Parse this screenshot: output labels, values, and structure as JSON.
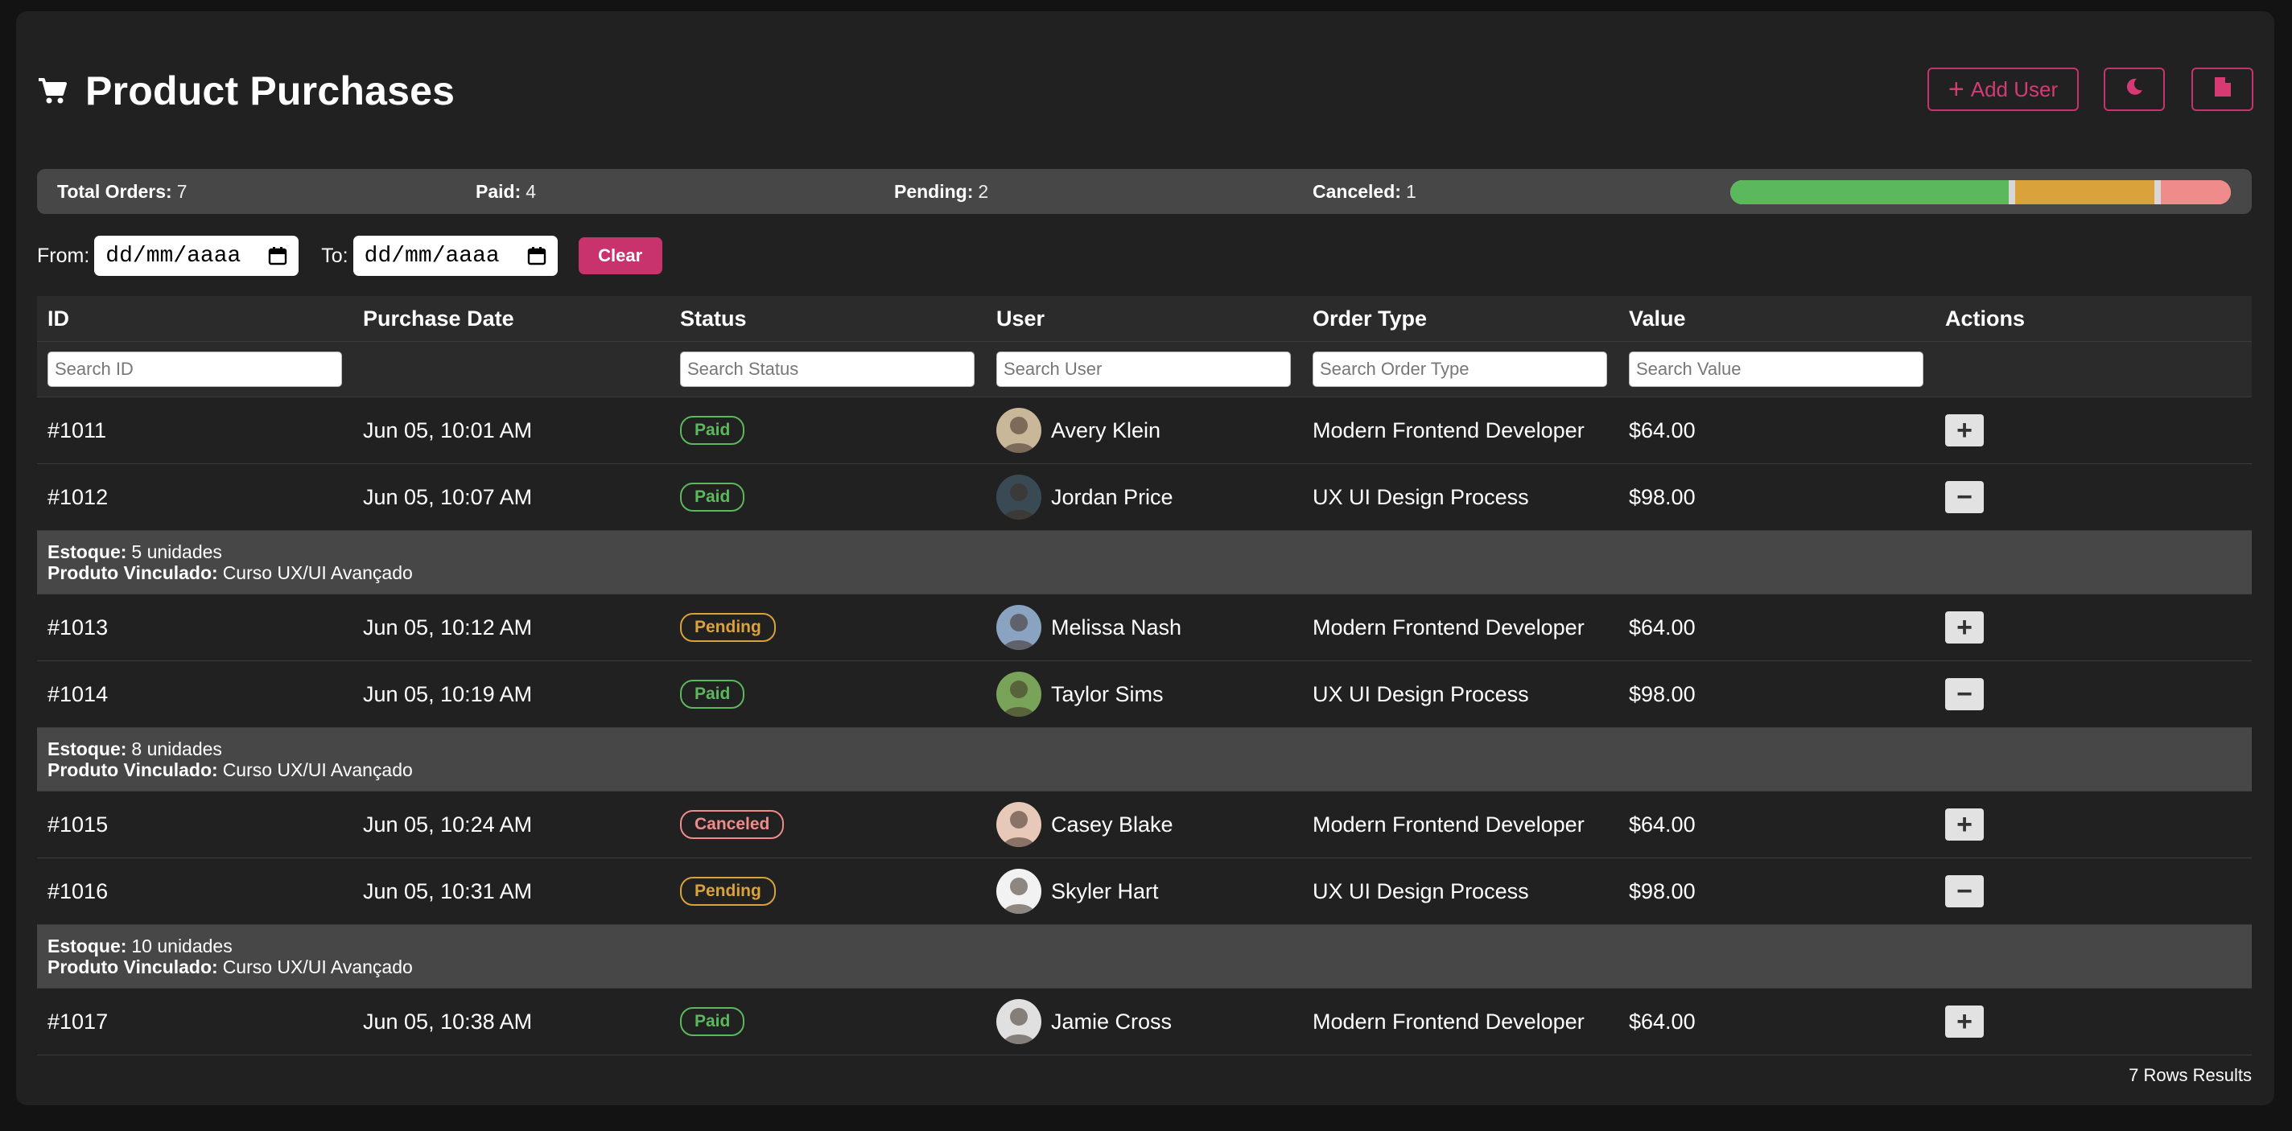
{
  "header": {
    "title": "Product Purchases",
    "icon": "cart-icon"
  },
  "buttons": {
    "add_user": "Add User",
    "add_icon": "+",
    "theme_icon": "moon-icon",
    "export_icon": "document-icon"
  },
  "colors": {
    "accent": "#c8326d",
    "paid": "#5cb85c",
    "pending": "#d9a23a",
    "canceled": "#f08b8b"
  },
  "summary": {
    "total_label": "Total Orders:",
    "total_value": "7",
    "paid_label": "Paid:",
    "paid_value": "4",
    "pending_label": "Pending:",
    "pending_value": "2",
    "canceled_label": "Canceled:",
    "canceled_value": "1",
    "progress": {
      "paid": 0.571,
      "pending": 0.286,
      "canceled": 0.143
    }
  },
  "filters": {
    "from_label": "From:",
    "to_label": "To:",
    "from_placeholder": "dd/mm/aaaa",
    "to_placeholder": "dd/mm/aaaa",
    "clear_label": "Clear"
  },
  "table": {
    "columns": [
      "ID",
      "Purchase Date",
      "Status",
      "User",
      "Order Type",
      "Value",
      "Actions"
    ],
    "search_placeholders": {
      "id": "Search ID",
      "status": "Search Status",
      "user": "Search User",
      "order_type": "Search Order Type",
      "value": "Search Value"
    },
    "rows": [
      {
        "id": "#1011",
        "date": "Jun 05, 10:01 AM",
        "status": "Paid",
        "user": "Avery Klein",
        "order_type": "Modern Frontend Developer",
        "value": "$64.00",
        "action": "+"
      },
      {
        "id": "#1012",
        "date": "Jun 05, 10:07 AM",
        "status": "Paid",
        "user": "Jordan Price",
        "order_type": "UX UI Design Process",
        "value": "$98.00",
        "action": "−",
        "detail": {
          "stock_label": "Estoque:",
          "stock_value": "5 unidades",
          "linked_label": "Produto Vinculado:",
          "linked_value": "Curso UX/UI Avançado"
        }
      },
      {
        "id": "#1013",
        "date": "Jun 05, 10:12 AM",
        "status": "Pending",
        "user": "Melissa Nash",
        "order_type": "Modern Frontend Developer",
        "value": "$64.00",
        "action": "+"
      },
      {
        "id": "#1014",
        "date": "Jun 05, 10:19 AM",
        "status": "Paid",
        "user": "Taylor Sims",
        "order_type": "UX UI Design Process",
        "value": "$98.00",
        "action": "−",
        "detail": {
          "stock_label": "Estoque:",
          "stock_value": "8 unidades",
          "linked_label": "Produto Vinculado:",
          "linked_value": "Curso UX/UI Avançado"
        }
      },
      {
        "id": "#1015",
        "date": "Jun 05, 10:24 AM",
        "status": "Canceled",
        "user": "Casey Blake",
        "order_type": "Modern Frontend Developer",
        "value": "$64.00",
        "action": "+"
      },
      {
        "id": "#1016",
        "date": "Jun 05, 10:31 AM",
        "status": "Pending",
        "user": "Skyler Hart",
        "order_type": "UX UI Design Process",
        "value": "$98.00",
        "action": "−",
        "detail": {
          "stock_label": "Estoque:",
          "stock_value": "10 unidades",
          "linked_label": "Produto Vinculado:",
          "linked_value": "Curso UX/UI Avançado"
        }
      },
      {
        "id": "#1017",
        "date": "Jun 05, 10:38 AM",
        "status": "Paid",
        "user": "Jamie Cross",
        "order_type": "Modern Frontend Developer",
        "value": "$64.00",
        "action": "+"
      }
    ]
  },
  "footer": {
    "results": "7 Rows Results"
  }
}
